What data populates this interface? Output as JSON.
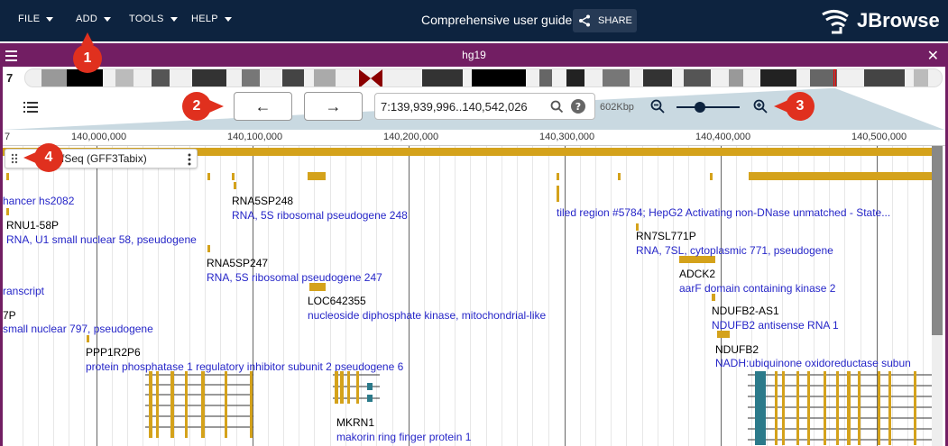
{
  "appbar": {
    "menus": [
      {
        "label": "FILE"
      },
      {
        "label": "ADD"
      },
      {
        "label": "TOOLS"
      },
      {
        "label": "HELP"
      }
    ],
    "session_title": "Comprehensive user guide",
    "share_label": "SHARE",
    "logo_text": "JBrowse"
  },
  "view": {
    "title": "hg19",
    "chromosome": "7",
    "location": "7:139,939,996..140,542,026",
    "size_label": "602Kbp",
    "zoom_level": 0.35
  },
  "ruler": {
    "left_label": "7",
    "ticks": [
      "140,000,000",
      "140,100,000",
      "140,200,000",
      "140,300,000",
      "140,400,000",
      "140,500,000"
    ]
  },
  "track": {
    "name": "NCBI RefSeq (GFF3Tabix)",
    "visible_name": "I RefSeq (GFF3Tabix)"
  },
  "features": [
    {
      "name": "",
      "desc": "hancer hs2082"
    },
    {
      "name": "RNA5SP248",
      "desc": "RNA, 5S ribosomal pseudogene 248"
    },
    {
      "name": "",
      "desc": "tiled region #5784; HepG2 Activating non-DNase unmatched - State..."
    },
    {
      "name": "RNU1-58P",
      "desc": "RNA, U1 small nuclear 58, pseudogene"
    },
    {
      "name": "RN7SL771P",
      "desc": "RNA, 7SL, cytoplasmic 771, pseudogene"
    },
    {
      "name": "RNA5SP247",
      "desc": "RNA, 5S ribosomal pseudogene 247"
    },
    {
      "name": "ADCK2",
      "desc": "aarF domain containing kinase 2"
    },
    {
      "name": "",
      "desc": "ranscript"
    },
    {
      "name": "LOC642355",
      "desc": "nucleoside diphosphate kinase, mitochondrial-like"
    },
    {
      "name": "NDUFB2-AS1",
      "desc": "NDUFB2 antisense RNA 1"
    },
    {
      "name": "7P",
      "desc": "small nuclear 797, pseudogene"
    },
    {
      "name": "NDUFB2",
      "desc": "NADH:ubiquinone oxidoreductase subun"
    },
    {
      "name": "PPP1R2P6",
      "desc": "protein phosphatase 1 regulatory inhibitor subunit 2 pseudogene 6"
    },
    {
      "name": "MKRN1",
      "desc": "makorin ring finger protein 1"
    }
  ],
  "callouts": [
    "1",
    "2",
    "3",
    "4"
  ],
  "colors": {
    "appbar": "#0d233f",
    "view_header": "#721e63",
    "feature": "#d4a21b",
    "description": "#2626c8",
    "callout": "#e0301e"
  }
}
